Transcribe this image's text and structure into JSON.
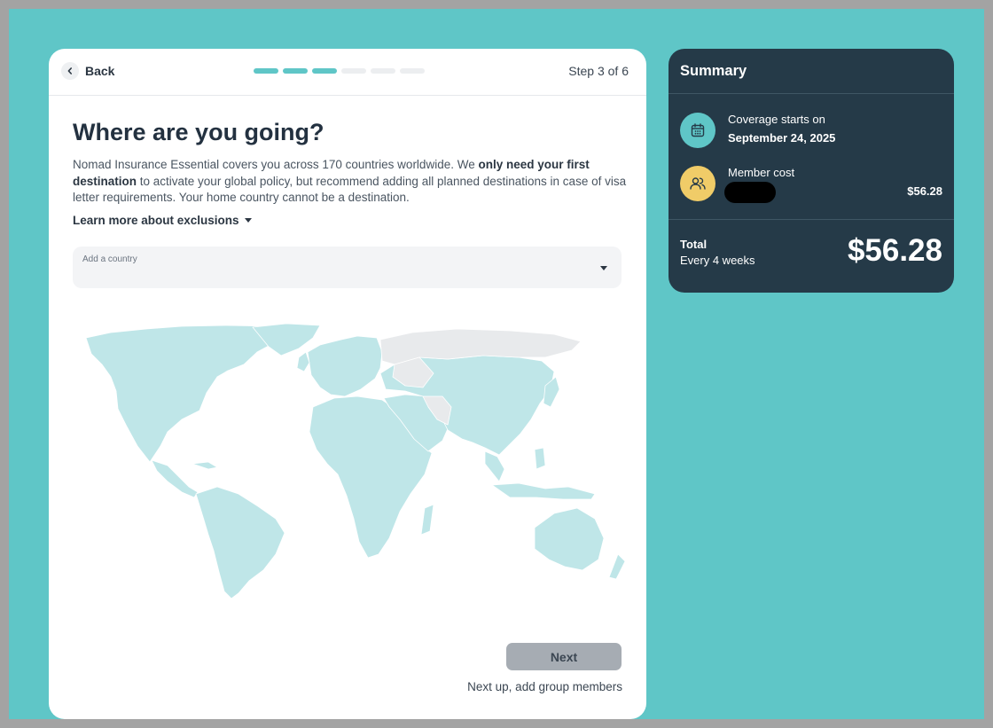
{
  "header": {
    "back_label": "Back",
    "step_label": "Step 3 of 6",
    "progress": {
      "current": 3,
      "total": 6
    }
  },
  "main": {
    "title": "Where are you going?",
    "description": {
      "part1": "Nomad Insurance Essential covers you across 170 countries worldwide. We ",
      "bold": "only need your first destination",
      "part2": " to activate your global policy, but recommend adding all planned destinations in case of visa letter requirements. Your home country cannot be a destination."
    },
    "learn_more": "Learn more about exclusions",
    "country_select": {
      "label": "Add a country"
    },
    "next_button": "Next",
    "next_hint": "Next up, add group members"
  },
  "summary": {
    "title": "Summary",
    "coverage_label": "Coverage starts on",
    "coverage_date": "September 24, 2025",
    "member_label": "Member cost",
    "member_amount": "$56.28",
    "total_label": "Total",
    "total_period": "Every 4 weeks",
    "total_amount": "$56.28"
  },
  "colors": {
    "accent": "#5fc6c7",
    "summary_bg": "#253a48",
    "member_icon_bg": "#f0cc68",
    "map_covered": "#bfe6e8",
    "map_excluded": "#e8eaec",
    "button_disabled": "#a6acb3"
  },
  "icons": {
    "back": "chevron-left-icon",
    "calendar": "calendar-icon",
    "members": "users-icon",
    "dropdown": "caret-down-icon"
  }
}
